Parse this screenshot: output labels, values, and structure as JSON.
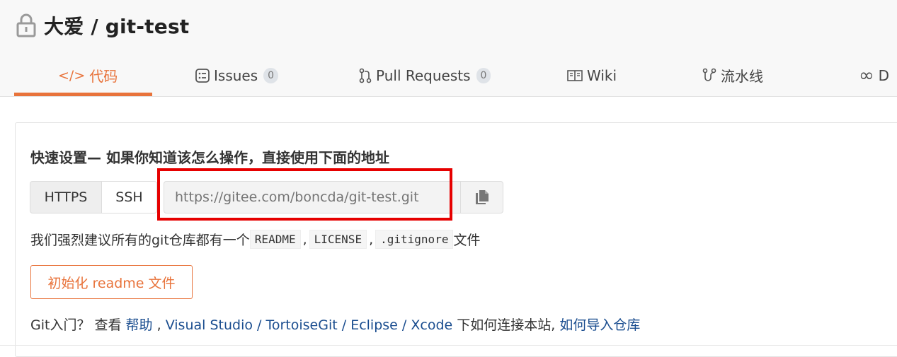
{
  "repo": {
    "title": "大爱 / git-test"
  },
  "tabs": [
    {
      "label": "代码",
      "icon": "code-icon",
      "active": true
    },
    {
      "label": "Issues",
      "icon": "issues-icon",
      "count": "0"
    },
    {
      "label": "Pull Requests",
      "icon": "pull-request-icon",
      "count": "0"
    },
    {
      "label": "Wiki",
      "icon": "wiki-icon"
    },
    {
      "label": "流水线",
      "icon": "pipeline-icon"
    },
    {
      "label": "D",
      "icon": "infinity-icon"
    }
  ],
  "quick_setup": {
    "title": "快速设置— 如果你知道该怎么操作，直接使用下面的地址",
    "https_label": "HTTPS",
    "ssh_label": "SSH",
    "url_placeholder": "https://gitee.com/boncda/git-test.git",
    "copy_icon": "copy-icon"
  },
  "recommend": {
    "prefix": "我们强烈建议所有的git仓库都有一个",
    "files": [
      "README",
      "LICENSE",
      ".gitignore"
    ],
    "sep": ",",
    "suffix": "文件"
  },
  "init_button": "初始化 readme 文件",
  "help": {
    "prefix": "Git入门？ 查看",
    "help_link": "帮助",
    "sep_comma": ",",
    "links": [
      "Visual Studio",
      "TortoiseGit",
      "Eclipse",
      "Xcode"
    ],
    "slash": "/",
    "mid": "下如何连接本站,",
    "import_link": "如何导入仓库"
  },
  "colors": {
    "accent": "#e8733b",
    "highlight_box": "#e60000",
    "link": "#1a4d8f"
  }
}
